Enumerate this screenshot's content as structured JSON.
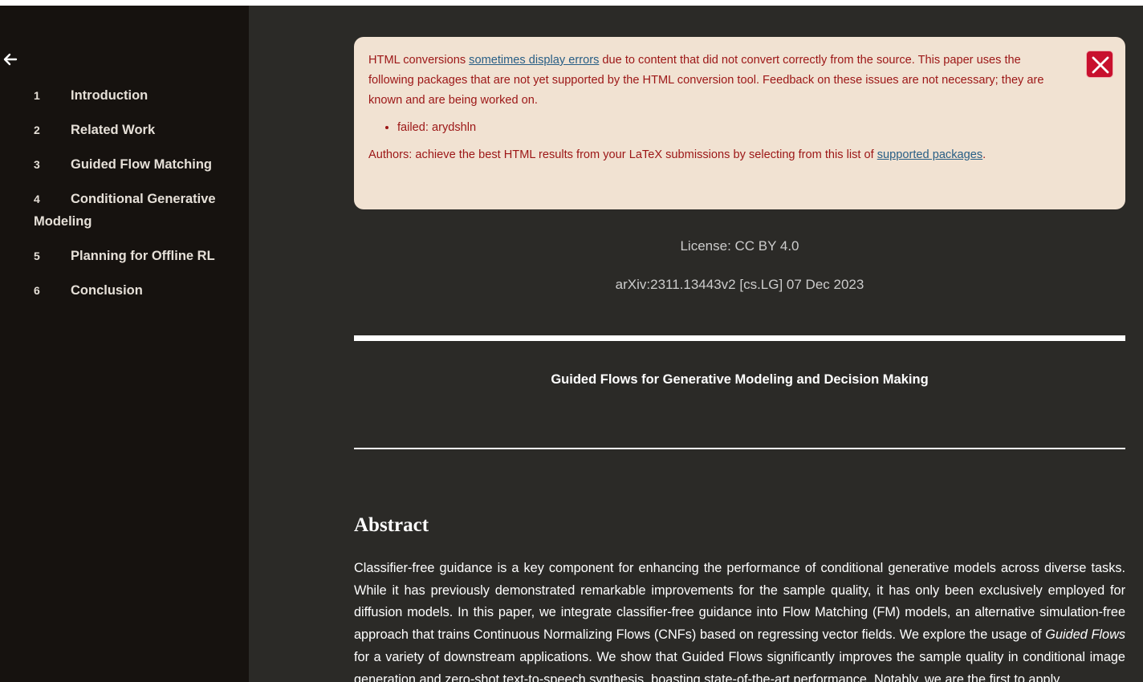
{
  "sidebar": {
    "back_icon": "arrow-left-icon",
    "toc": [
      {
        "num": "1",
        "label": "Introduction"
      },
      {
        "num": "2",
        "label": "Related Work"
      },
      {
        "num": "3",
        "label": "Guided Flow Matching"
      },
      {
        "num": "4",
        "label": "Conditional Generative Modeling"
      },
      {
        "num": "5",
        "label": "Planning for Offline RL"
      },
      {
        "num": "6",
        "label": "Conclusion"
      }
    ]
  },
  "notice": {
    "text_before_link": "HTML conversions ",
    "link1": "sometimes display errors",
    "text_after_link": " due to content that did not convert correctly from the source. This paper uses the following packages that are not yet supported by the HTML conversion tool. Feedback on these issues are not necessary; they are known and are being worked on.",
    "failed_item": "failed: arydshln",
    "authors_text": "Authors: achieve the best HTML results from your LaTeX submissions by selecting from this list of ",
    "link2": "supported packages",
    "authors_end": ".",
    "close_icon": "close-icon"
  },
  "meta": {
    "license": "License: CC BY 4.0",
    "arxiv": "arXiv:2311.13443v2 [cs.LG] 07 Dec 2023"
  },
  "paper": {
    "title": "Guided Flows for Generative Modeling and Decision Making",
    "abstract_heading": "Abstract",
    "abstract_part1": "Classifier-free guidance is a key component for enhancing the performance of conditional generative models across diverse tasks. While it has previously demonstrated remarkable improvements for the sample quality, it has only been exclusively employed for diffusion models. In this paper, we integrate classifier-free guidance into Flow Matching (FM) models, an alternative simulation-free approach that trains Continuous Normalizing Flows (CNFs) based on regressing vector fields. We explore the usage of ",
    "abstract_italic": "Guided Flows",
    "abstract_part2": " for a variety of downstream applications. We show that Guided Flows significantly improves the sample quality in conditional image generation and zero-shot text-to-speech synthesis, boasting state-of-the-art performance. Notably, we are the first to apply"
  },
  "colors": {
    "sidebar_bg": "#16120f",
    "main_bg": "#2b2a27",
    "notice_bg": "#f1e2d2",
    "notice_text": "#9c1616",
    "close_bg": "#c8102e"
  }
}
